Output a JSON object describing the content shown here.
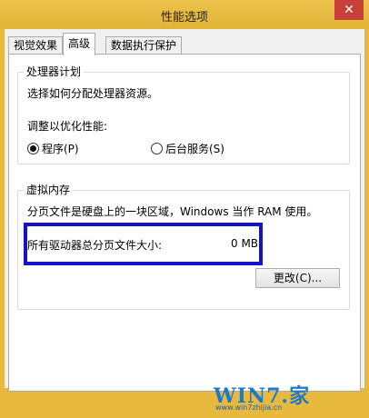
{
  "window": {
    "title": "性能选项",
    "close_glyph": "✕"
  },
  "tabs": [
    {
      "label": "视觉效果",
      "active": false
    },
    {
      "label": "高级",
      "active": true
    },
    {
      "label": "数据执行保护",
      "active": false
    }
  ],
  "processor": {
    "legend": "处理器计划",
    "description": "选择如何分配处理器资源。",
    "adjust_label": "调整以优化性能:",
    "options": [
      {
        "label": "程序(P)",
        "selected": true
      },
      {
        "label": "后台服务(S)",
        "selected": false
      }
    ]
  },
  "virtual_memory": {
    "legend": "虚拟内存",
    "description": "分页文件是硬盘上的一块区域，Windows 当作 RAM 使用。",
    "total_label": "所有驱动器总分页文件大小:",
    "total_value": "0 MB",
    "change_button": "更改(C)..."
  },
  "watermark": {
    "brand": "WIN7.",
    "char": "家",
    "url": "www.win7zhijia.cn"
  },
  "colors": {
    "title_bar": "#e7ba3e",
    "highlight": "#1313c8",
    "close": "#c7413a"
  }
}
